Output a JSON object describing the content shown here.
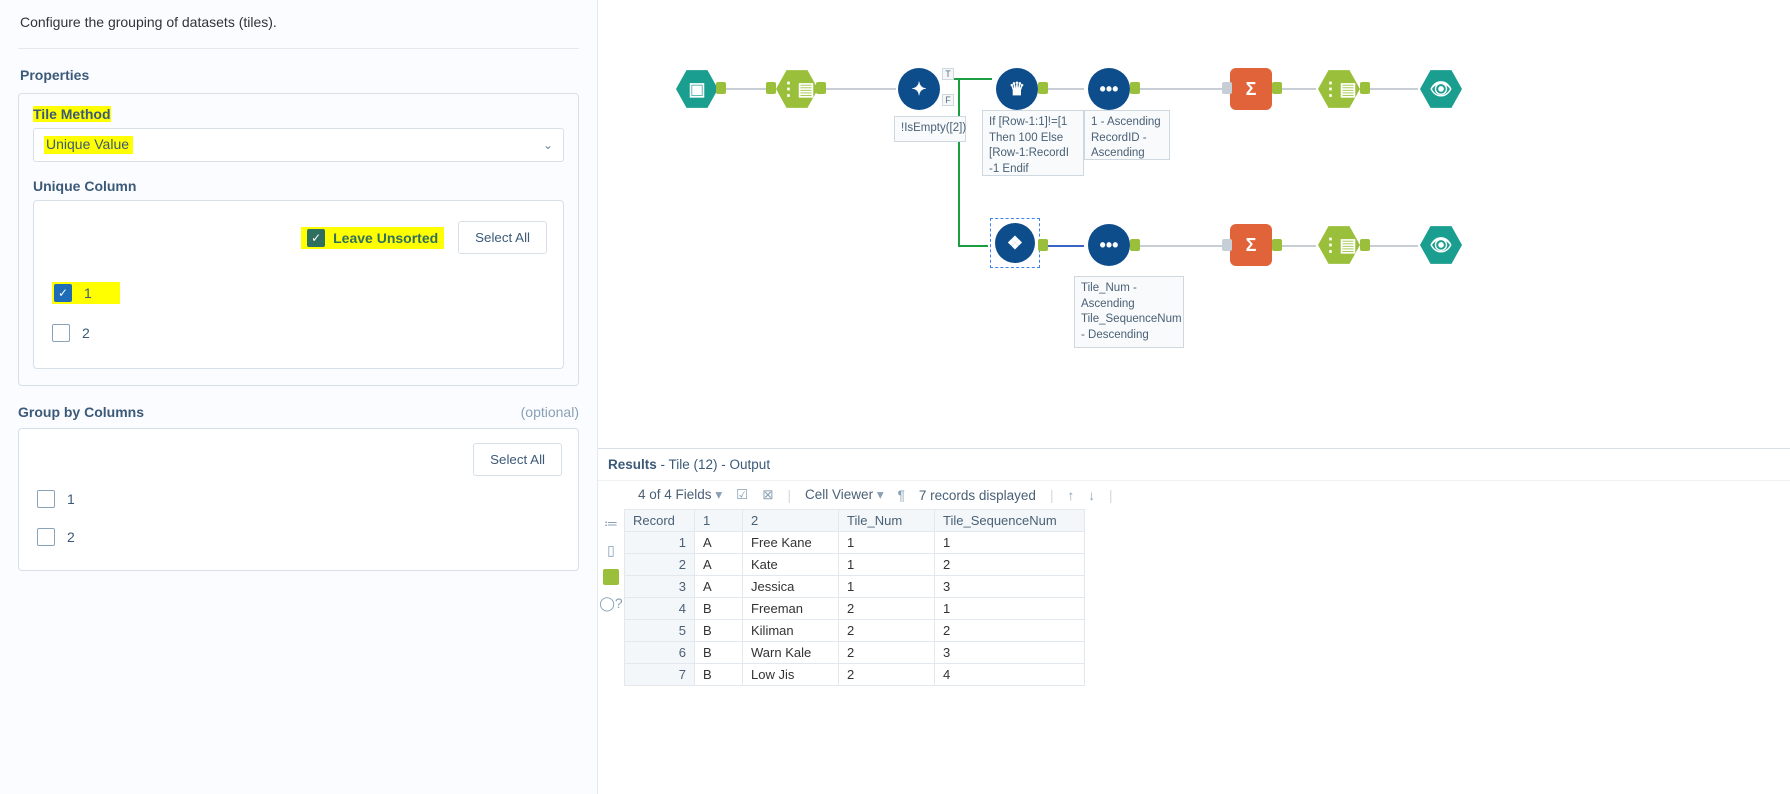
{
  "config": {
    "page_desc": "Configure the grouping of datasets (tiles).",
    "properties_title": "Properties",
    "tile_method_label": "Tile Method",
    "tile_method_value": "Unique Value",
    "unique_column_label": "Unique Column",
    "leave_unsorted_label": "Leave Unsorted",
    "select_all_label": "Select All",
    "unique_items": [
      {
        "label": "1",
        "checked": true
      },
      {
        "label": "2",
        "checked": false
      }
    ],
    "groupby_label": "Group by Columns",
    "optional_label": "(optional)",
    "groupby_items": [
      {
        "label": "1",
        "checked": false
      },
      {
        "label": "2",
        "checked": false
      }
    ]
  },
  "canvas": {
    "anno_formula": "!IsEmpty([2])",
    "anno_multirow": "If [Row-1:1]!=[1 Then 100 Else [Row-1:RecordI -1 Endif",
    "anno_sort1": "1 - Ascending RecordID - Ascending",
    "anno_sort2": "Tile_Num - Ascending Tile_SequenceNum - Descending"
  },
  "results": {
    "header_strong": "Results",
    "header_rest": " - Tile (12) - Output",
    "fields_label": "4 of 4 Fields",
    "cell_viewer_label": "Cell Viewer",
    "records_label": "7 records displayed",
    "columns": [
      "Record",
      "1",
      "2",
      "Tile_Num",
      "Tile_SequenceNum"
    ],
    "rows": [
      [
        "1",
        "A",
        "Free Kane",
        "1",
        "1"
      ],
      [
        "2",
        "A",
        "Kate",
        "1",
        "2"
      ],
      [
        "3",
        "A",
        "Jessica",
        "1",
        "3"
      ],
      [
        "4",
        "B",
        "Freeman",
        "2",
        "1"
      ],
      [
        "5",
        "B",
        "Kiliman",
        "2",
        "2"
      ],
      [
        "6",
        "B",
        "Warn Kale",
        "2",
        "3"
      ],
      [
        "7",
        "B",
        "Low Jis",
        "2",
        "4"
      ]
    ]
  }
}
